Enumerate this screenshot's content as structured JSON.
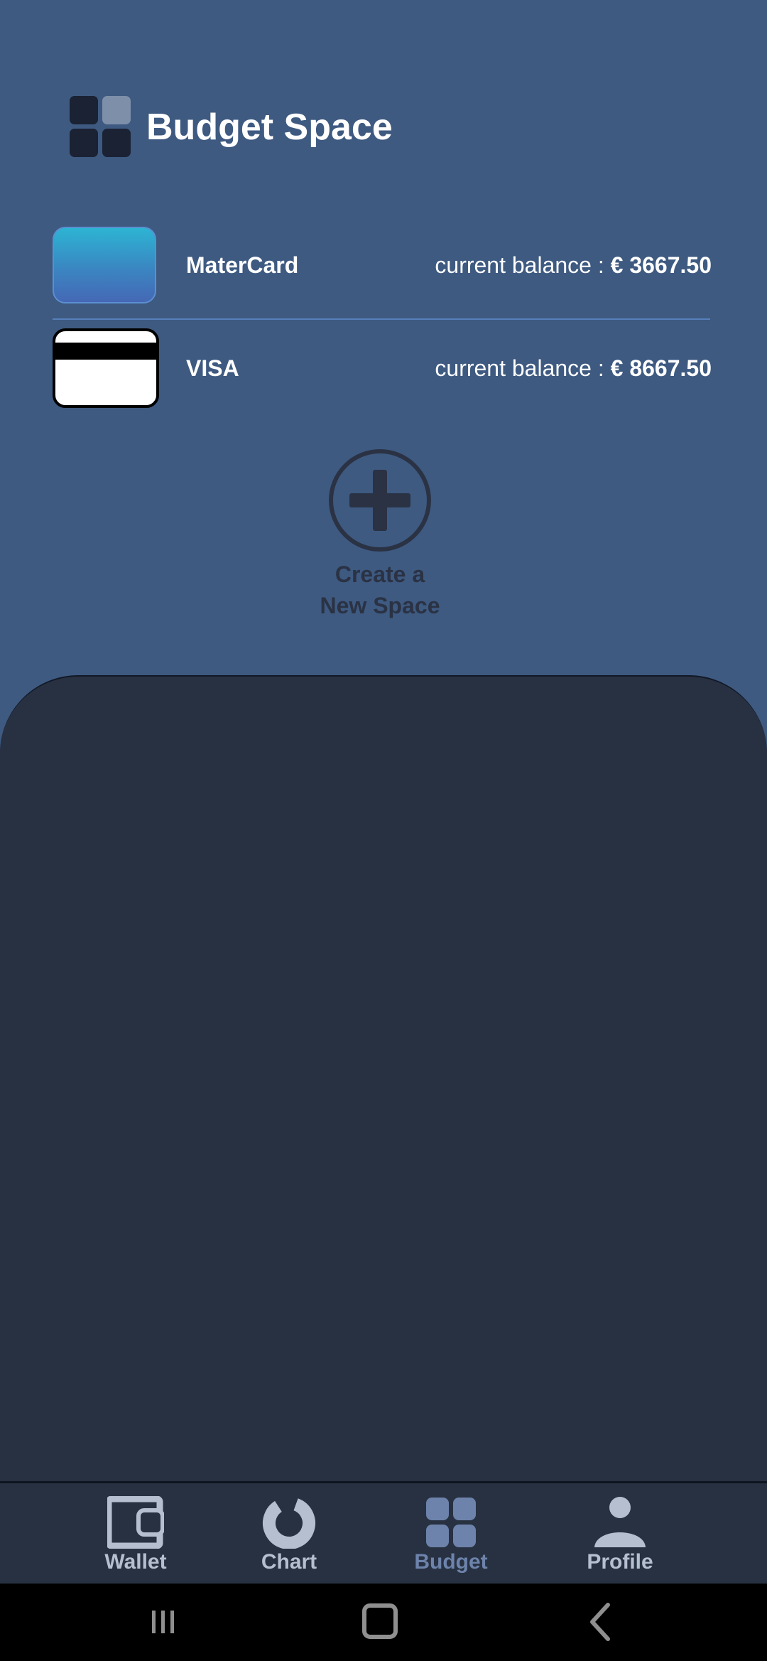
{
  "header": {
    "title": "Budget Space",
    "logo_icon": "grid-logo-icon"
  },
  "cards": [
    {
      "name": "MaterCard",
      "balance_label": "current balance : ",
      "balance_value": "€ 3667.50",
      "icon": "mastercard-card-icon"
    },
    {
      "name": "VISA",
      "balance_label": "current balance : ",
      "balance_value": "€ 8667.50",
      "icon": "visa-card-icon"
    }
  ],
  "create_space": {
    "line1": "Create a",
    "line2": "New Space",
    "icon": "plus-circle-icon"
  },
  "bottom_nav": {
    "items": [
      {
        "label": "Wallet",
        "icon": "wallet-icon",
        "active": false
      },
      {
        "label": "Chart",
        "icon": "donut-chart-icon",
        "active": false
      },
      {
        "label": "Budget",
        "icon": "grid-icon",
        "active": true
      },
      {
        "label": "Profile",
        "icon": "person-icon",
        "active": false
      }
    ]
  },
  "system_nav": {
    "recent_icon": "recent-apps-icon",
    "home_icon": "home-icon",
    "back_icon": "back-icon"
  },
  "colors": {
    "background": "#3e5a81",
    "sheet": "#283142",
    "active_nav": "#6d83ab",
    "inactive_nav": "#b5bfcf"
  }
}
